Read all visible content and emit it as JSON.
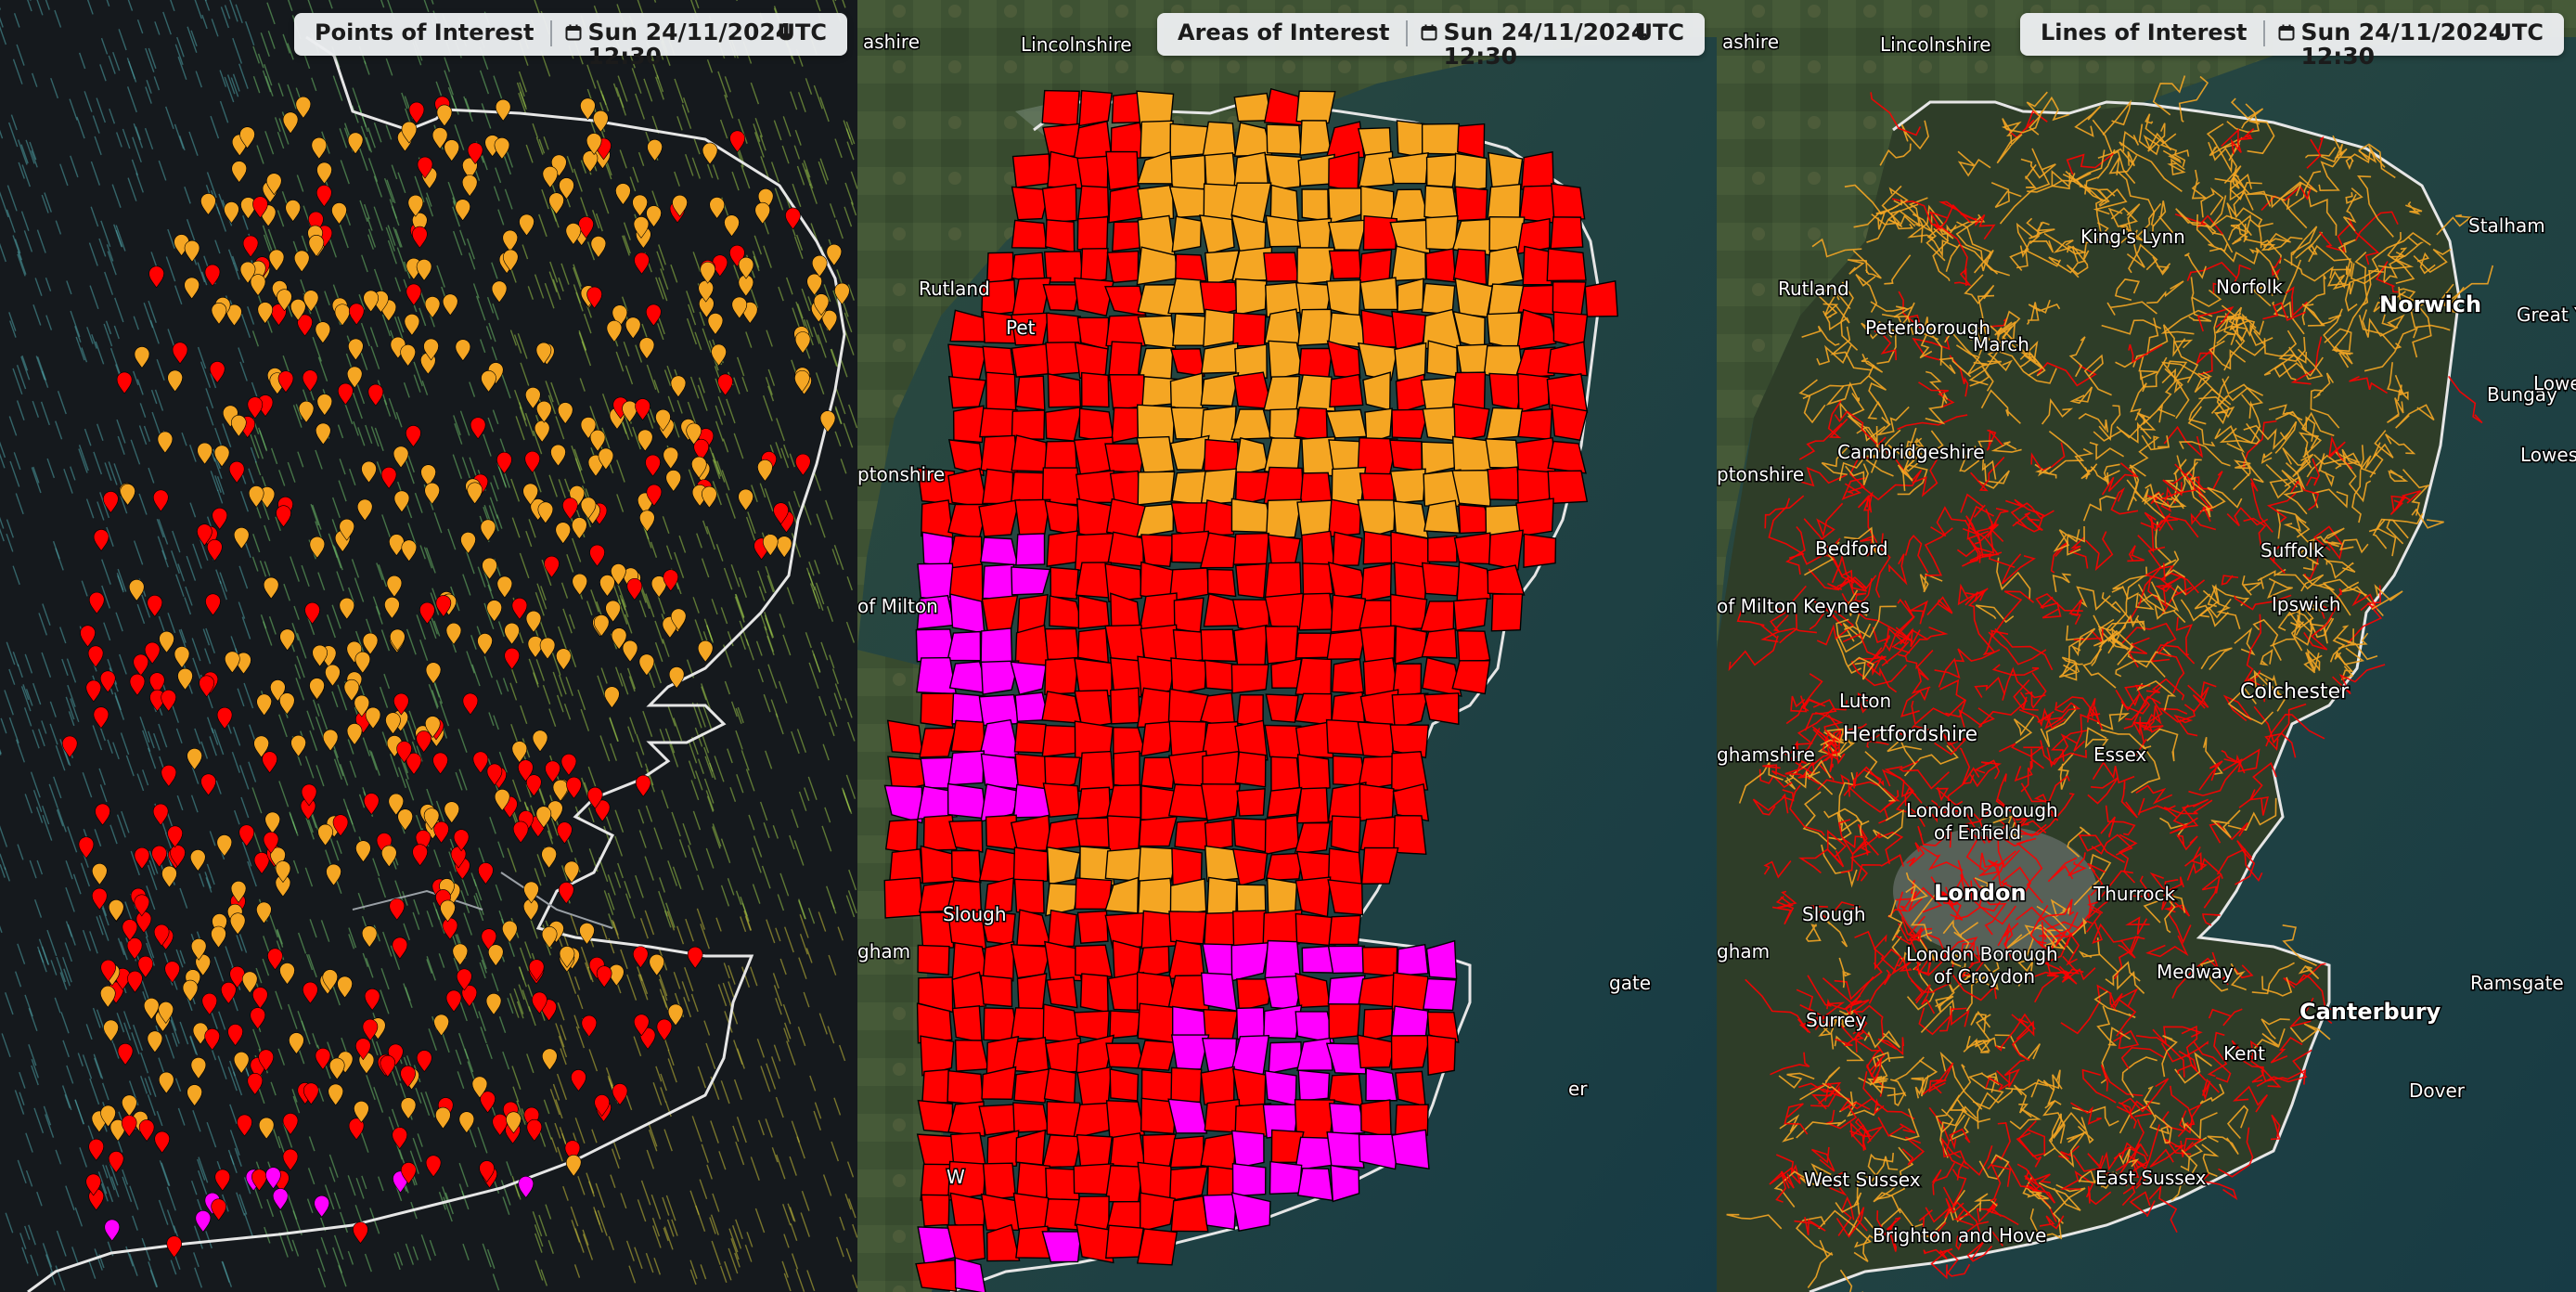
{
  "colors": {
    "alert_red": "#ff0000",
    "alert_amber": "#f5a623",
    "alert_magenta": "#ff00ff",
    "header_bg": "#eceef0",
    "coast": "#e8e8e8"
  },
  "icons": {
    "calendar": "calendar-icon"
  },
  "panels": [
    {
      "title": "Points of Interest",
      "date": "Sun 24/11/2024",
      "time": "12:30",
      "tz": "UTC",
      "basemap": "dark",
      "layer": "wind-particles",
      "places": []
    },
    {
      "title": "Areas of Interest",
      "date": "Sun 24/11/2024",
      "time": "12:30",
      "tz": "UTC",
      "basemap": "satellite",
      "layer": "polygons",
      "places": [
        "ashire",
        "Lincolnshire",
        "Rutland",
        "Pet",
        "ptonshire",
        "of Milton",
        "Slough",
        "gham",
        "W",
        "gate",
        "er"
      ]
    },
    {
      "title": "Lines of Interest",
      "date": "Sun 24/11/2024",
      "time": "12:30",
      "tz": "UTC",
      "basemap": "satellite",
      "layer": "lines",
      "places": [
        "ashire",
        "Lincolnshire",
        "Rutland",
        "Peterborough",
        "King's Lynn",
        "Norfolk",
        "Norwich",
        "Great Yar",
        "Cambridgeshire",
        "March",
        "Bungay",
        "Lowest",
        "Lowestoft",
        "ptonshire",
        "Bedford",
        "Suffolk",
        "of Milton Keynes",
        "Ipswich",
        "Luton",
        "Hertfordshire",
        "Colchester",
        "ghamshire",
        "Essex",
        "London Borough of Enfield",
        "London",
        "Thurrock",
        "Slough",
        "gham",
        "London Borough of Croydon",
        "Medway",
        "Ramsgate",
        "Surrey",
        "Canterbury",
        "Kent",
        "Dover",
        "West Sussex",
        "East Sussex",
        "Brighton and Hove",
        "Stalham"
      ]
    }
  ]
}
